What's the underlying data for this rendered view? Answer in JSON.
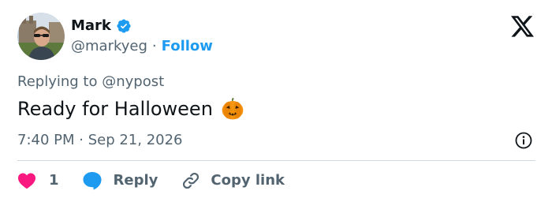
{
  "author": {
    "name": "Mark",
    "handle": "@markyeg",
    "separator": "·",
    "follow_label": "Follow"
  },
  "tweet": {
    "replying_prefix": "Replying to ",
    "replying_to": "@nypost",
    "text": "Ready for Halloween",
    "emoji": "pumpkin",
    "time": "7:40 PM",
    "date_separator": " · ",
    "date": "Sep 21, 2026"
  },
  "actions": {
    "like_count": "1",
    "reply_label": "Reply",
    "copy_label": "Copy link"
  },
  "icons": {
    "logo": "x-logo-icon",
    "verified": "verified-badge-icon",
    "info": "info-icon",
    "like": "heart-icon",
    "reply": "chat-bubble-icon",
    "copy": "link-icon"
  },
  "colors": {
    "accent": "#1d9bf0",
    "like": "#f91880",
    "text_primary": "#0f1419",
    "text_secondary": "#536471",
    "divider": "#cfd9de"
  }
}
